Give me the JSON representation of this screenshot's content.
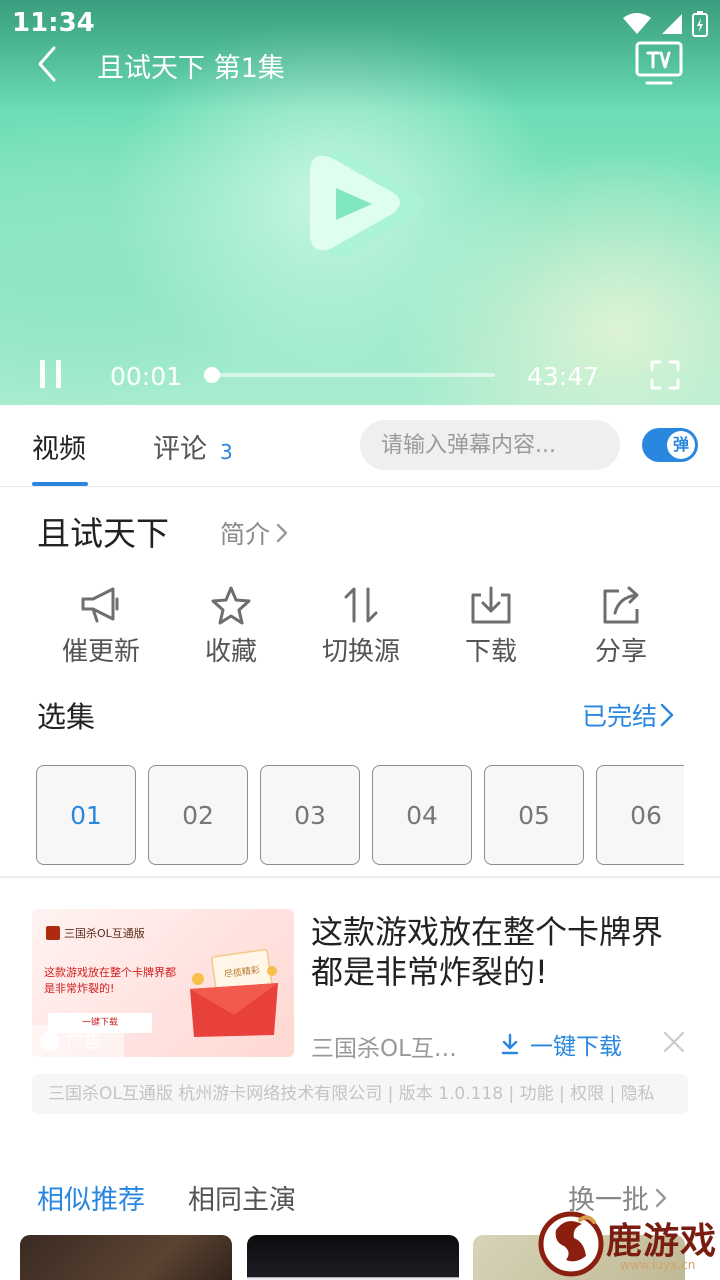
{
  "status_bar": {
    "time": "11:34"
  },
  "player": {
    "title": "且试天下 第1集",
    "current_time": "00:01",
    "total_time": "43:47",
    "progress": 0.0004,
    "state": "playing"
  },
  "tabs": {
    "video_label": "视频",
    "comments_label": "评论",
    "comments_count": "3"
  },
  "danmaku": {
    "placeholder": "请输入弹幕内容...",
    "toggle_label": "弹",
    "enabled": true
  },
  "show": {
    "title": "且试天下",
    "intro_label": "简介"
  },
  "actions": [
    {
      "label": "催更新",
      "icon": "megaphone-icon"
    },
    {
      "label": "收藏",
      "icon": "star-icon"
    },
    {
      "label": "切换源",
      "icon": "switch-arrows-icon"
    },
    {
      "label": "下载",
      "icon": "download-icon"
    },
    {
      "label": "分享",
      "icon": "share-icon"
    }
  ],
  "episodes": {
    "title": "选集",
    "status": "已完结",
    "items": [
      "01",
      "02",
      "03",
      "04",
      "05",
      "06"
    ],
    "selected": "01"
  },
  "ad": {
    "headline": "这款游戏放在整个卡牌界都是非常炸裂的!",
    "source": "三国杀OL互通版",
    "download_label": "一键下载",
    "badge": "广告",
    "thumb_brand": "三国杀OL互通版",
    "thumb_line1": "这款游戏放在整个卡牌界都",
    "thumb_line2": "是非常炸裂的!",
    "thumb_button": "一键下载",
    "thumb_envelope_text": "尽揽精彩",
    "info": "三国杀OL互通版 杭州游卡网络技术有限公司 | 版本 1.0.118 | 功能 | 权限 | 隐私"
  },
  "recommend": {
    "tab_similar": "相似推荐",
    "tab_same_cast": "相同主演",
    "refresh": "换一批"
  },
  "watermark": {
    "text": "鹿游戏",
    "url": "www.luyx.cn"
  },
  "colors": {
    "accent": "#2a87e0",
    "text": "#222222",
    "muted": "#8a8a8a"
  }
}
